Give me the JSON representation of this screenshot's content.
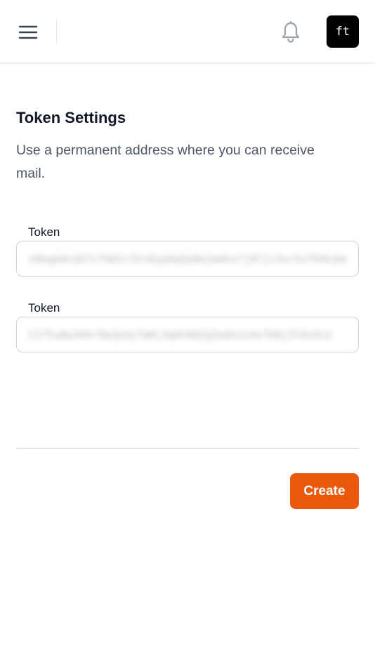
{
  "header": {
    "menu_icon": "hamburger-menu-icon",
    "notification_icon": "bell-icon",
    "avatar_initials": "ft"
  },
  "main": {
    "title": "Token Settings",
    "description": "Use a permanent address where you can receive mail.",
    "fields": [
      {
        "label": "Token",
        "value": "x8kgm4n2b7cf9d1r3tv6yp0q5w8e2a4hs7j9l1z3xc5v7b9n2m4"
      },
      {
        "label": "Token",
        "value": "t1f5u8w3k6r9a2p4y7m0c3q6h9d2g5e8n1s4v7b0j3l6x9z2"
      }
    ],
    "create_label": "Create"
  },
  "colors": {
    "accent": "#ea580c",
    "avatar_bg": "#000000",
    "title_text": "#111827",
    "muted_text": "#4b5563",
    "border": "#d1d5db"
  }
}
